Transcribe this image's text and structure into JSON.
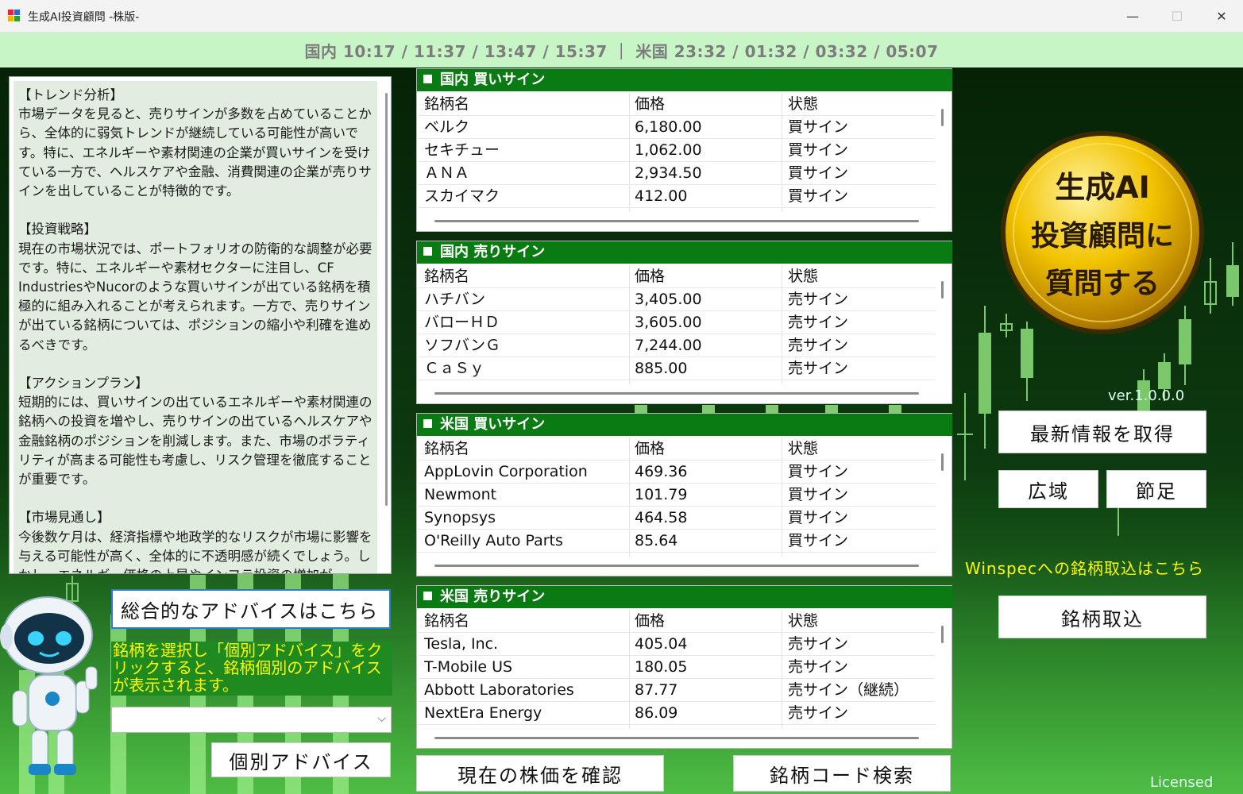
{
  "window": {
    "title": "生成AI投資顧問 -株版-",
    "minimize": "—",
    "maximize": "☐",
    "close": "✕"
  },
  "timebar": {
    "text": "国内 10:17 / 11:37 / 13:47 / 15:37 ｜ 米国 23:32 / 01:32 / 03:32 / 05:07"
  },
  "advice": {
    "text": "【トレンド分析】\n市場データを見ると、売りサインが多数を占めていることから、全体的に弱気トレンドが継続している可能性が高いです。特に、エネルギーや素材関連の企業が買いサインを受けている一方で、ヘルスケアや金融、消費関連の企業が売りサインを出していることが特徴的です。\n\n【投資戦略】\n現在の市場状況では、ポートフォリオの防衛的な調整が必要です。特に、エネルギーや素材セクターに注目し、CF IndustriesやNucorのような買いサインが出ている銘柄を積極的に組み入れることが考えられます。一方で、売りサインが出ている銘柄については、ポジションの縮小や利確を進めるべきです。\n\n【アクションプラン】\n短期的には、買いサインの出ているエネルギーや素材関連の銘柄への投資を増やし、売りサインの出ているヘルスケアや金融銘柄のポジションを削減します。また、市場のボラティリティが高まる可能性も考慮し、リスク管理を徹底することが重要です。\n\n【市場見通し】\n今後数ケ月は、経済指標や地政学的なリスクが市場に影響を与える可能性が高く、全体的に不透明感が続くでしょう。しかし、エネルギー価格の上昇やインフラ投資の増加が"
  },
  "left_controls": {
    "overall_button": "総合的なアドバイスはこちら",
    "hint": "銘柄を選択し「個別アドバイス」をクリックすると、銘柄個別のアドバイスが表示されます。",
    "select_value": "",
    "individual_button": "個別アドバイス"
  },
  "columns": {
    "name": "銘柄名",
    "price": "価格",
    "status": "状態"
  },
  "panels": [
    {
      "title": "国内 買いサイン",
      "rows": [
        {
          "name": "ベルク",
          "price": "6,180.00",
          "status": "買サイン"
        },
        {
          "name": "セキチュー",
          "price": "1,062.00",
          "status": "買サイン"
        },
        {
          "name": "ＡＮＡ",
          "price": "2,934.50",
          "status": "買サイン"
        },
        {
          "name": "スカイマク",
          "price": "412.00",
          "status": "買サイン"
        }
      ]
    },
    {
      "title": "国内 売りサイン",
      "rows": [
        {
          "name": "ハチバン",
          "price": "3,405.00",
          "status": "売サイン"
        },
        {
          "name": "バローＨＤ",
          "price": "3,605.00",
          "status": "売サイン"
        },
        {
          "name": "ソフバンＧ",
          "price": "7,244.00",
          "status": "売サイン"
        },
        {
          "name": "ＣａＳｙ",
          "price": "885.00",
          "status": "売サイン"
        }
      ]
    },
    {
      "title": "米国 買いサイン",
      "rows": [
        {
          "name": "AppLovin Corporation",
          "price": "469.36",
          "status": "買サイン"
        },
        {
          "name": "Newmont",
          "price": "101.79",
          "status": "買サイン"
        },
        {
          "name": "Synopsys",
          "price": "464.58",
          "status": "買サイン"
        },
        {
          "name": "O'Reilly Auto Parts",
          "price": "85.64",
          "status": "買サイン"
        }
      ]
    },
    {
      "title": "米国 売りサイン",
      "rows": [
        {
          "name": "Tesla, Inc.",
          "price": "405.04",
          "status": "売サイン"
        },
        {
          "name": "T-Mobile US",
          "price": "180.05",
          "status": "売サイン"
        },
        {
          "name": "Abbott Laboratories",
          "price": "87.77",
          "status": "売サイン（継続）"
        },
        {
          "name": "NextEra Energy",
          "price": "86.09",
          "status": "売サイン"
        }
      ]
    }
  ],
  "bottom_buttons": {
    "check_price": "現在の株価を確認",
    "code_search": "銘柄コード検索"
  },
  "right": {
    "ask_ai_line1": "生成AI",
    "ask_ai_line2": "投資顧問に",
    "ask_ai_line3": "質問する",
    "version": "ver.1.0.0.0",
    "get_latest": "最新情報を取得",
    "wide": "広域",
    "node": "節足",
    "winspec_text": "Winspecへの銘柄取込はこちら",
    "import_button": "銘柄取込",
    "licensed": "Licensed"
  },
  "colors": {
    "accent_green": "#0a7a12",
    "timebar_bg": "#c8f5c6",
    "hint_yellow": "#fffa00",
    "gold": "#e8b400"
  }
}
